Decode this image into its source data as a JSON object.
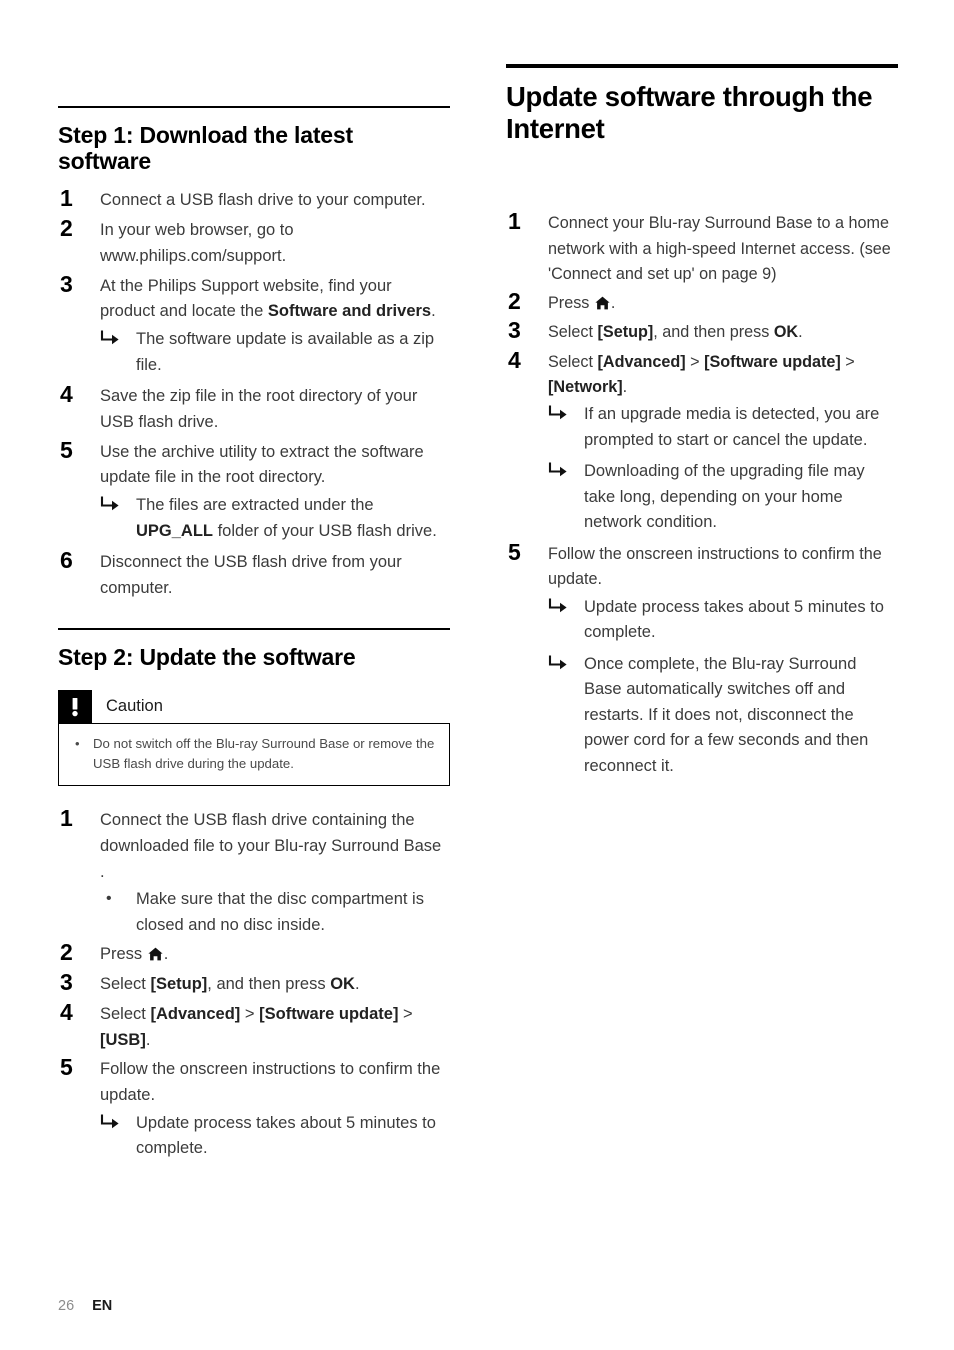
{
  "page": {
    "number": "26",
    "language_code": "EN"
  },
  "left_column": {
    "section1": {
      "heading": "Step 1: Download the latest software",
      "steps": [
        {
          "parts": [
            {
              "t": "Connect a USB flash drive to your computer.",
              "b": false
            }
          ],
          "results": [],
          "subnotes": []
        },
        {
          "parts": [
            {
              "t": "In your web browser, go to www.philips.com/support.",
              "b": false
            }
          ],
          "results": [],
          "subnotes": []
        },
        {
          "parts": [
            {
              "t": "At the Philips Support website, find your product and locate the ",
              "b": false
            },
            {
              "t": "Software and drivers",
              "b": true
            },
            {
              "t": ".",
              "b": false
            }
          ],
          "results": [
            {
              "parts": [
                {
                  "t": "The software update is available as a zip file.",
                  "b": false
                }
              ]
            }
          ],
          "subnotes": []
        },
        {
          "parts": [
            {
              "t": "Save the zip file in the root directory of your USB flash drive.",
              "b": false
            }
          ],
          "results": [],
          "subnotes": []
        },
        {
          "parts": [
            {
              "t": "Use the archive utility to extract the software update file in the root directory.",
              "b": false
            }
          ],
          "results": [
            {
              "parts": [
                {
                  "t": "The files are extracted under the ",
                  "b": false
                },
                {
                  "t": "UPG_ALL",
                  "b": true
                },
                {
                  "t": " folder of your USB flash drive.",
                  "b": false
                }
              ]
            }
          ],
          "subnotes": []
        },
        {
          "parts": [
            {
              "t": "Disconnect the USB flash drive from your computer.",
              "b": false
            }
          ],
          "results": [],
          "subnotes": []
        }
      ]
    },
    "section2": {
      "heading": "Step 2: Update the software",
      "caution": {
        "badge_icon": "exclamation-icon",
        "title": "Caution",
        "items": [
          "Do not switch off the Blu-ray Surround Base  or remove the USB flash drive during the update."
        ]
      },
      "steps": [
        {
          "parts": [
            {
              "t": "Connect the USB flash drive containing the downloaded file to your Blu-ray Surround Base .",
              "b": false
            }
          ],
          "results": [],
          "subnotes": [
            "Make sure that the disc compartment is closed and no disc inside."
          ]
        },
        {
          "parts": [
            {
              "t": "Press ",
              "b": false
            },
            {
              "t": "",
              "b": false,
              "icon": "home-icon"
            },
            {
              "t": ".",
              "b": false
            }
          ],
          "results": [],
          "subnotes": []
        },
        {
          "parts": [
            {
              "t": "Select ",
              "b": false
            },
            {
              "t": "[Setup]",
              "b": true
            },
            {
              "t": ", and then press ",
              "b": false
            },
            {
              "t": "OK",
              "b": true
            },
            {
              "t": ".",
              "b": false
            }
          ],
          "results": [],
          "subnotes": []
        },
        {
          "parts": [
            {
              "t": "Select ",
              "b": false
            },
            {
              "t": "[Advanced]",
              "b": true
            },
            {
              "t": " > ",
              "b": false
            },
            {
              "t": "[Software update]",
              "b": true
            },
            {
              "t": " > ",
              "b": false
            },
            {
              "t": "[USB]",
              "b": true
            },
            {
              "t": ".",
              "b": false
            }
          ],
          "results": [],
          "subnotes": []
        },
        {
          "parts": [
            {
              "t": "Follow the onscreen instructions to confirm the update.",
              "b": false
            }
          ],
          "results": [
            {
              "parts": [
                {
                  "t": "Update process takes about 5 minutes to complete.",
                  "b": false
                }
              ]
            }
          ],
          "subnotes": []
        }
      ]
    }
  },
  "right_column": {
    "heading": "Update software through the Internet",
    "steps": [
      {
        "parts": [
          {
            "t": "Connect your Blu-ray Surround Base  to a home network with a high-speed Internet access. (see 'Connect and set up' on page 9)",
            "b": false
          }
        ],
        "results": [],
        "subnotes": []
      },
      {
        "parts": [
          {
            "t": "Press ",
            "b": false
          },
          {
            "t": "",
            "b": false,
            "icon": "home-icon"
          },
          {
            "t": ".",
            "b": false
          }
        ],
        "results": [],
        "subnotes": []
      },
      {
        "parts": [
          {
            "t": "Select ",
            "b": false
          },
          {
            "t": "[Setup]",
            "b": true
          },
          {
            "t": ", and then press ",
            "b": false
          },
          {
            "t": "OK",
            "b": true
          },
          {
            "t": ".",
            "b": false
          }
        ],
        "results": [],
        "subnotes": []
      },
      {
        "parts": [
          {
            "t": "Select ",
            "b": false
          },
          {
            "t": "[Advanced]",
            "b": true
          },
          {
            "t": " > ",
            "b": false
          },
          {
            "t": "[Software update]",
            "b": true
          },
          {
            "t": " > ",
            "b": false
          },
          {
            "t": "[Network]",
            "b": true
          },
          {
            "t": ".",
            "b": false
          }
        ],
        "results": [
          {
            "parts": [
              {
                "t": "If an upgrade media is detected, you are prompted to start or cancel the update.",
                "b": false
              }
            ]
          },
          {
            "parts": [
              {
                "t": "Downloading of the upgrading file may take long, depending on your home network condition.",
                "b": false
              }
            ]
          }
        ],
        "subnotes": []
      },
      {
        "parts": [
          {
            "t": "Follow the onscreen instructions to confirm the update.",
            "b": false
          }
        ],
        "results": [
          {
            "parts": [
              {
                "t": "Update process takes about 5 minutes to complete.",
                "b": false
              }
            ]
          },
          {
            "parts": [
              {
                "t": "Once complete, the Blu-ray Surround Base  automatically switches off and restarts. If it does not, disconnect the power cord for a few seconds and then reconnect it.",
                "b": false
              }
            ]
          }
        ],
        "subnotes": []
      }
    ]
  },
  "icons": {
    "arrow_bullet": "arrow-turn-right-icon",
    "dot_bullet": "•",
    "home_key": "home-icon"
  },
  "colors": {
    "text": "#3b3b3b",
    "heading": "#000000",
    "rule": "#000000",
    "page_number": "#8c8c8c"
  }
}
